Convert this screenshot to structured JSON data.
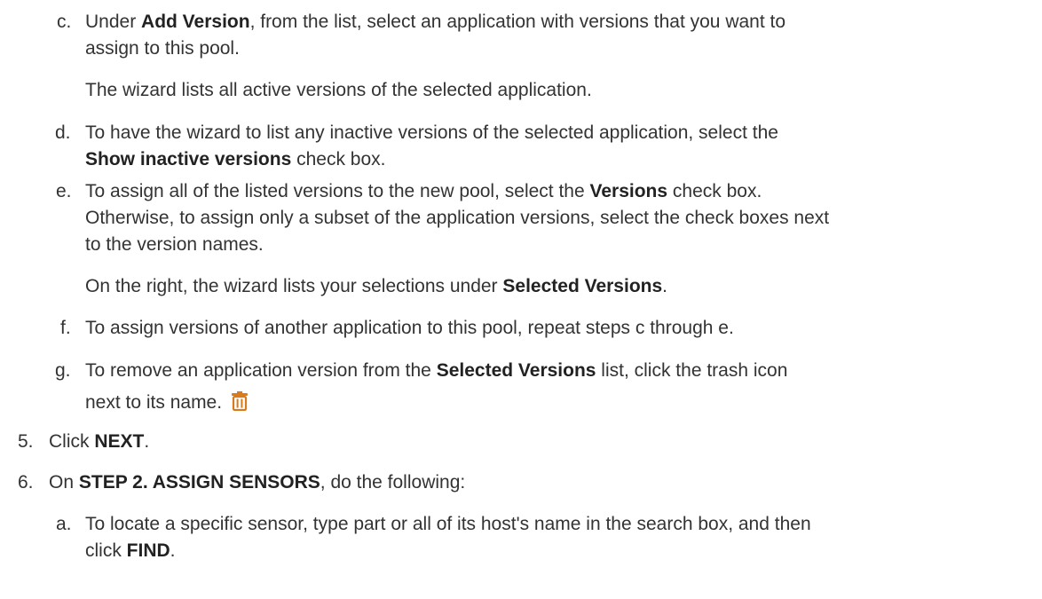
{
  "steps": {
    "step_c": {
      "marker": "c.",
      "line1_pre": "Under ",
      "line1_bold": "Add Version",
      "line1_post": ", from the list, select an application with versions that you want to",
      "line2": "assign to this pool.",
      "note": "The wizard lists all active versions of the selected application."
    },
    "step_d": {
      "marker": "d.",
      "line1": "To have the wizard to list any inactive versions of the selected application, select the",
      "line2_bold": "Show inactive versions",
      "line2_post": " check box."
    },
    "step_e": {
      "marker": "e.",
      "line1_pre": "To assign all of the listed versions to the new pool, select the ",
      "line1_bold": "Versions",
      "line1_post": " check box.",
      "line2": "Otherwise, to assign only a subset of the application versions, select the check boxes next",
      "line3": "to the version names.",
      "note_pre": "On the right, the wizard lists your selections under ",
      "note_bold": "Selected Versions",
      "note_post": "."
    },
    "step_f": {
      "marker": "f.",
      "line1": "To assign versions of another application to this pool, repeat steps c through e."
    },
    "step_g": {
      "marker": "g.",
      "line1_pre": "To remove an application version from the ",
      "line1_bold": "Selected Versions",
      "line1_post": " list, click the trash icon",
      "line2": "next to its name.",
      "icon": "trash-icon",
      "icon_color": "#d97b1a"
    },
    "step_5": {
      "marker": "5.",
      "pre": "Click ",
      "bold": "NEXT",
      "post": "."
    },
    "step_6": {
      "marker": "6.",
      "pre": "On ",
      "bold": "STEP 2. ASSIGN SENSORS",
      "post": ", do the following:"
    },
    "step_6a": {
      "marker": "a.",
      "line1": "To locate a specific sensor, type part or all of its host's name in the search box, and then",
      "line2_pre": "click ",
      "line2_bold": "FIND",
      "line2_post": "."
    }
  }
}
